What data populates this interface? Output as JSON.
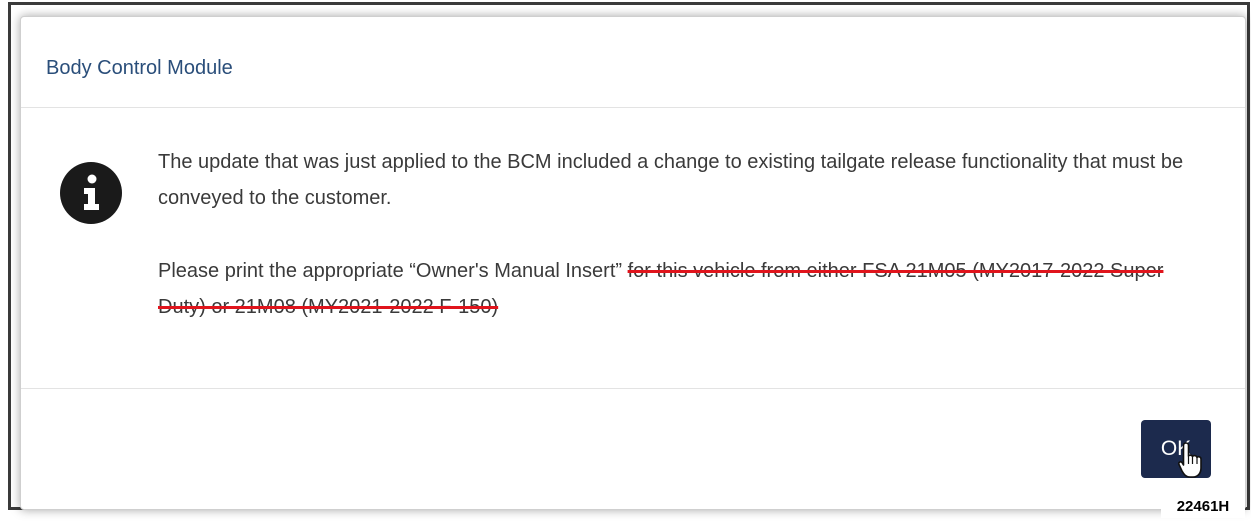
{
  "dialog": {
    "title": "Body Control Module",
    "icon": "info-circle-icon",
    "message_paragraph_1": "The update that was just applied to the BCM included a change to existing tailgate release functionality that must be conveyed to the customer.",
    "message_paragraph_2_plain": "Please print the appropriate “Owner's Manual Insert”",
    "message_paragraph_2_struck": "for this vehicle from either FSA 21M05 (MY2017-2022 Super Duty) or 21M08 (MY2021-2022 F-150)",
    "ok_label": "OK"
  },
  "figure_label": "22461H",
  "colors": {
    "title": "#2a4e7a",
    "ok_button": "#1c2a4d",
    "strikethrough": "#e0141c"
  }
}
